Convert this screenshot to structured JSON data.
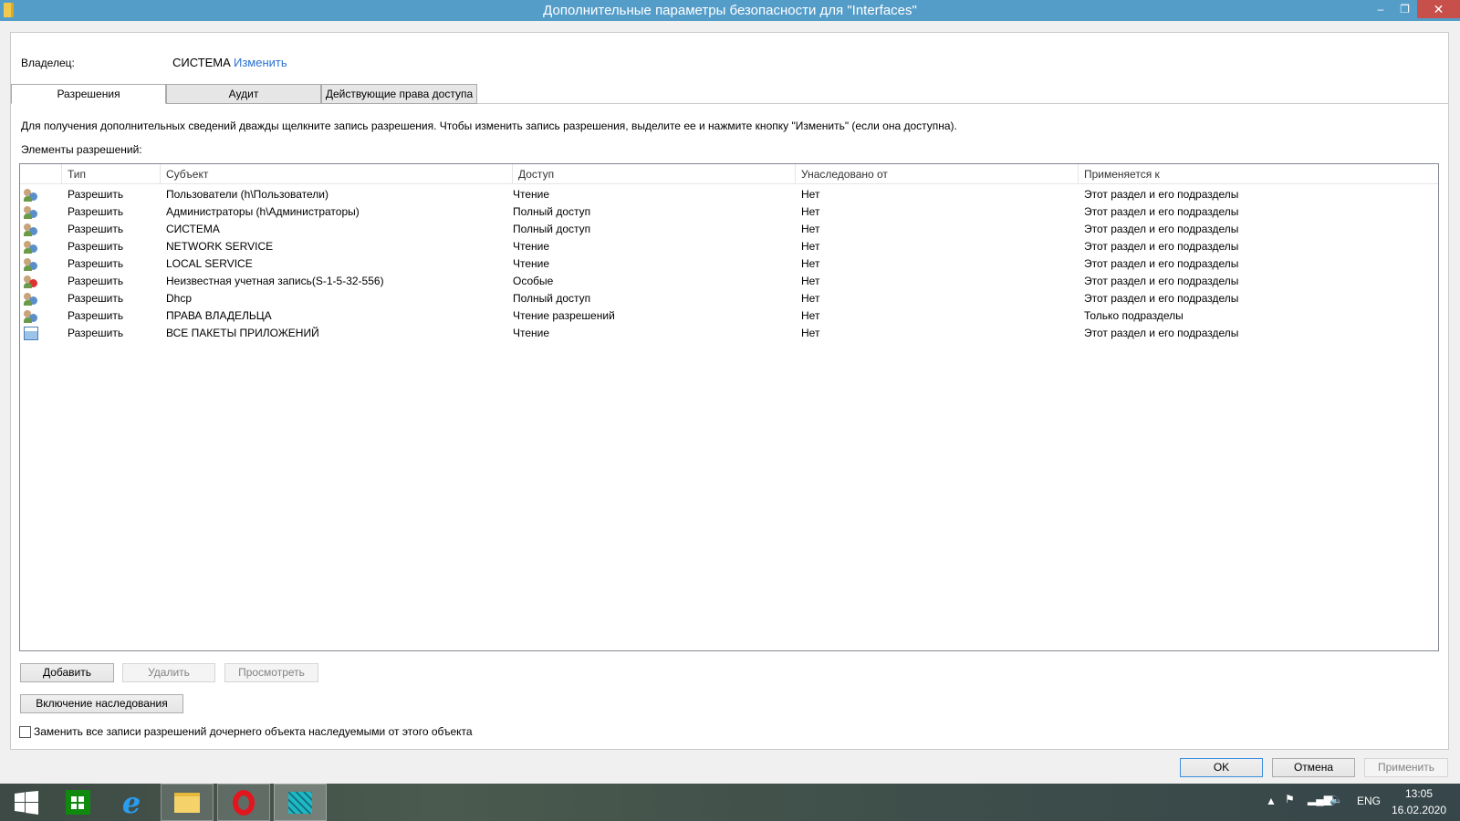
{
  "window": {
    "title": "Дополнительные параметры безопасности  для \"Interfaces\""
  },
  "owner": {
    "label": "Владелец:",
    "value": "СИСТЕМА",
    "change_link": "Изменить"
  },
  "tabs": [
    {
      "label": "Разрешения",
      "active": true
    },
    {
      "label": "Аудит"
    },
    {
      "label": "Действующие права доступа"
    }
  ],
  "info_text": "Для получения дополнительных сведений дважды щелкните запись разрешения. Чтобы изменить запись разрешения, выделите ее и нажмите кнопку \"Изменить\" (если она доступна).",
  "list_label": "Элементы разрешений:",
  "columns": [
    "Тип",
    "Субъект",
    "Доступ",
    "Унаследовано от",
    "Применяется к"
  ],
  "rows": [
    {
      "icon": "users-icon",
      "type": "Разрешить",
      "subject": "Пользователи (h\\Пользователи)",
      "access": "Чтение",
      "inherited": "Нет",
      "applies": "Этот раздел и его подразделы"
    },
    {
      "icon": "users-icon",
      "type": "Разрешить",
      "subject": "Администраторы (h\\Администраторы)",
      "access": "Полный доступ",
      "inherited": "Нет",
      "applies": "Этот раздел и его подразделы"
    },
    {
      "icon": "users-icon",
      "type": "Разрешить",
      "subject": "СИСТЕМА",
      "access": "Полный доступ",
      "inherited": "Нет",
      "applies": "Этот раздел и его подразделы"
    },
    {
      "icon": "users-icon",
      "type": "Разрешить",
      "subject": "NETWORK SERVICE",
      "access": "Чтение",
      "inherited": "Нет",
      "applies": "Этот раздел и его подразделы"
    },
    {
      "icon": "users-icon",
      "type": "Разрешить",
      "subject": "LOCAL SERVICE",
      "access": "Чтение",
      "inherited": "Нет",
      "applies": "Этот раздел и его подразделы"
    },
    {
      "icon": "unknown-user-icon",
      "type": "Разрешить",
      "subject": "Неизвестная учетная запись(S-1-5-32-556)",
      "access": "Особые",
      "inherited": "Нет",
      "applies": "Этот раздел и его подразделы"
    },
    {
      "icon": "users-icon",
      "type": "Разрешить",
      "subject": "Dhcp",
      "access": "Полный доступ",
      "inherited": "Нет",
      "applies": "Этот раздел и его подразделы"
    },
    {
      "icon": "users-icon",
      "type": "Разрешить",
      "subject": "ПРАВА ВЛАДЕЛЬЦА",
      "access": "Чтение разрешений",
      "inherited": "Нет",
      "applies": "Только подразделы"
    },
    {
      "icon": "app-packages-icon",
      "type": "Разрешить",
      "subject": "ВСЕ ПАКЕТЫ ПРИЛОЖЕНИЙ",
      "access": "Чтение",
      "inherited": "Нет",
      "applies": "Этот раздел и его подразделы"
    }
  ],
  "buttons": {
    "add": "Добавить",
    "remove": "Удалить",
    "view": "Просмотреть",
    "enable_inheritance": "Включение наследования",
    "ok": "OK",
    "cancel": "Отмена",
    "apply": "Применить"
  },
  "replace_checkbox": {
    "label": "Заменить все записи разрешений дочернего объекта наследуемыми от этого объекта",
    "checked": false
  },
  "taskbar": {
    "language": "ENG",
    "time": "13:05",
    "date": "16.02.2020"
  }
}
